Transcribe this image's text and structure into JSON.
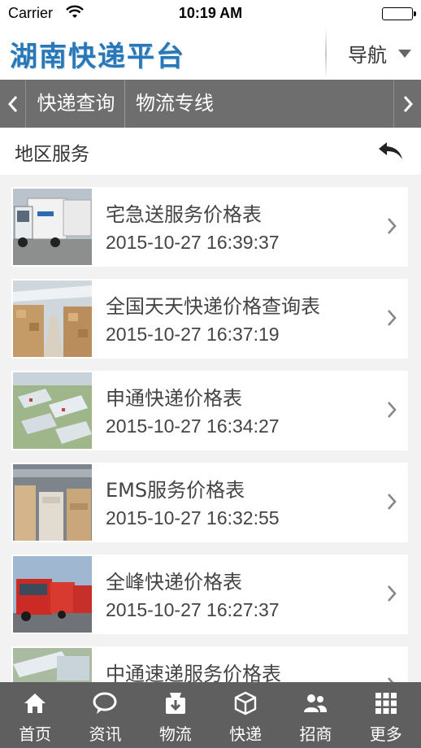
{
  "status_bar": {
    "carrier": "Carrier",
    "time": "10:19 AM"
  },
  "header": {
    "brand": "湖南快递平台",
    "nav_label": "导航"
  },
  "tabs": [
    {
      "label": "快递查询"
    },
    {
      "label": "物流专线"
    }
  ],
  "section": {
    "title": "地区服务"
  },
  "items": [
    {
      "title": "宅急送服务价格表",
      "time": "2015-10-27 16:39:37",
      "thumb": "trucks-photo"
    },
    {
      "title": "全国天天快递价格查询表",
      "time": "2015-10-27 16:37:19",
      "thumb": "warehouse-photo"
    },
    {
      "title": "申通快递价格表",
      "time": "2015-10-27 16:34:27",
      "thumb": "aerial-campus-photo"
    },
    {
      "title": "EMS服务价格表",
      "time": "2015-10-27 16:32:55",
      "thumb": "parcel-stacks-photo"
    },
    {
      "title": "全峰快递价格表",
      "time": "2015-10-27 16:27:37",
      "thumb": "red-trucks-photo"
    },
    {
      "title": "中通速递服务价格表",
      "time": "",
      "thumb": "aerial-buildings-photo"
    }
  ],
  "bottom_nav": [
    {
      "label": "首页",
      "icon": "home-icon"
    },
    {
      "label": "资讯",
      "icon": "chat-bubble-icon"
    },
    {
      "label": "物流",
      "icon": "box-down-icon"
    },
    {
      "label": "快递",
      "icon": "cube-icon"
    },
    {
      "label": "招商",
      "icon": "people-icon"
    },
    {
      "label": "更多",
      "icon": "grid-icon"
    }
  ],
  "colors": {
    "brand": "#2878b8",
    "tabbar": "#6e6e6e",
    "bottombar": "#5f5f5f",
    "background": "#f2f2f2"
  }
}
